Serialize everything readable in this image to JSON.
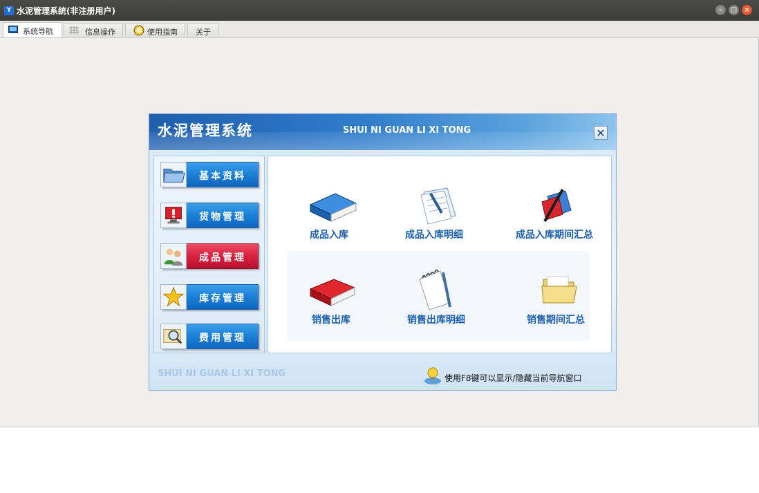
{
  "window": {
    "title": "水泥管理系统(非注册用户)"
  },
  "tabs": [
    {
      "label": "系统导航"
    },
    {
      "label": "信息操作"
    },
    {
      "label": "使用指南"
    },
    {
      "label": "关于"
    }
  ],
  "dialog": {
    "title": "水泥管理系统",
    "subtitle": "SHUI NI GUAN LI XI TONG",
    "close_glyph": "✕",
    "footer_subtitle": "SHUI NI GUAN LI XI TONG",
    "hint": "使用F8键可以显示/隐藏当前导航窗口"
  },
  "nav": [
    {
      "label": "基本资料",
      "icon": "folder-icon"
    },
    {
      "label": "货物管理",
      "icon": "alert-monitor-icon"
    },
    {
      "label": "成品管理",
      "icon": "users-icon"
    },
    {
      "label": "库存管理",
      "icon": "star-icon"
    },
    {
      "label": "费用管理",
      "icon": "magnifier-icon"
    }
  ],
  "functions": [
    {
      "label": "成品入库",
      "icon": "blue-book-icon"
    },
    {
      "label": "成品入库明细",
      "icon": "document-pen-icon"
    },
    {
      "label": "成品入库期间汇总",
      "icon": "pen-folder-icon"
    },
    {
      "label": "销售出库",
      "icon": "red-book-icon"
    },
    {
      "label": "销售出库明细",
      "icon": "notepad-pen-icon"
    },
    {
      "label": "销售期间汇总",
      "icon": "open-folder-icon"
    }
  ],
  "colors": {
    "accent": "#1b7fd6",
    "selected": "#d9213f",
    "label": "#1b5fae"
  }
}
